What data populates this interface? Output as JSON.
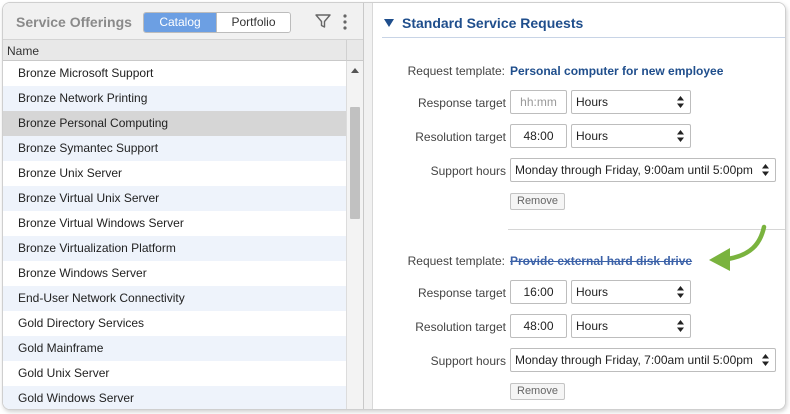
{
  "left_panel": {
    "title": "Service Offerings",
    "tabs": [
      {
        "label": "Catalog",
        "active": true
      },
      {
        "label": "Portfolio",
        "active": false
      }
    ],
    "icons": [
      "filter-icon",
      "more-icon"
    ],
    "column_header": "Name",
    "rows": [
      "Bronze Microsoft Support",
      "Bronze Network Printing",
      "Bronze Personal Computing",
      "Bronze Symantec Support",
      "Bronze Unix Server",
      "Bronze Virtual Unix Server",
      "Bronze Virtual Windows Server",
      "Bronze Virtualization Platform",
      "Bronze Windows Server",
      "End-User Network Connectivity",
      "Gold Directory Services",
      "Gold Mainframe",
      "Gold Unix Server",
      "Gold Windows Server"
    ],
    "selected_row": "Bronze Personal Computing"
  },
  "right_panel": {
    "section_title": "Standard Service Requests",
    "labels": {
      "request_template": "Request template:",
      "response_target": "Response target",
      "resolution_target": "Resolution target",
      "support_hours": "Support hours",
      "remove": "Remove"
    },
    "request1": {
      "template": "Personal computer for new employee",
      "response_value": "",
      "response_placeholder": "hh:mm",
      "response_unit": "Hours",
      "resolution_value": "48:00",
      "resolution_unit": "Hours",
      "support_hours": "Monday through Friday, 9:00am until 5:00pm"
    },
    "request2": {
      "template": "Provide external hard disk drive",
      "template_struck": true,
      "response_value": "16:00",
      "response_unit": "Hours",
      "resolution_value": "48:00",
      "resolution_unit": "Hours",
      "support_hours": "Monday through Friday, 7:00am until 5:00pm"
    },
    "colors": {
      "accent": "#1f4e8c",
      "active_tab": "#6c9fe3",
      "callout_arrow": "#7ab33e"
    }
  }
}
